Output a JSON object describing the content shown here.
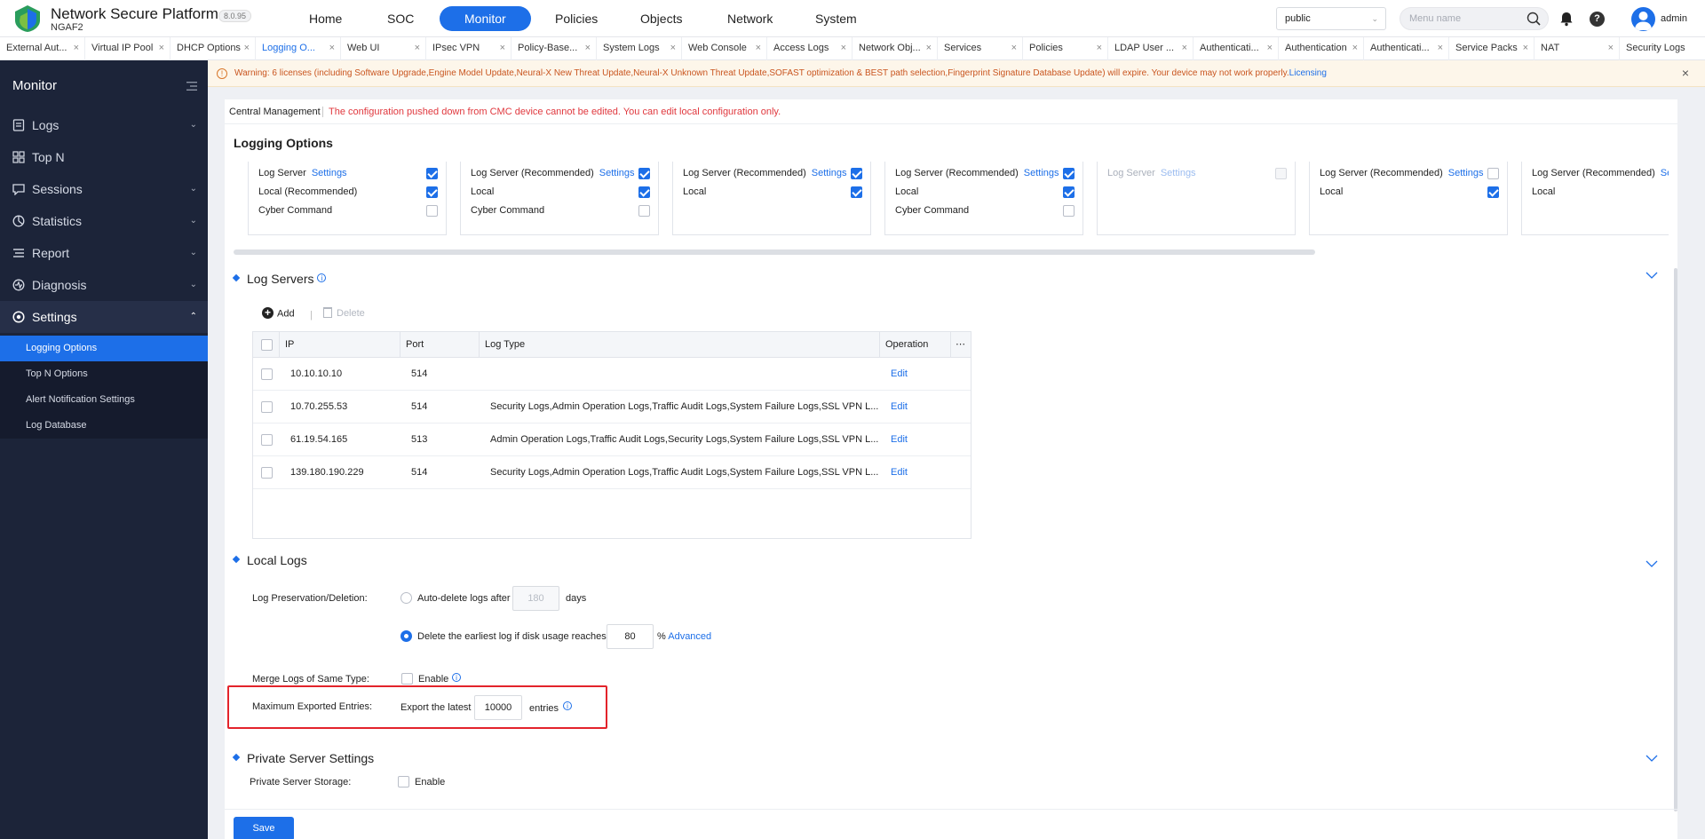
{
  "app": {
    "title": "Network Secure Platform",
    "subtitle": "NGAF2",
    "version": "8.0.95"
  },
  "nav": {
    "items": [
      "Home",
      "SOC",
      "Monitor",
      "Policies",
      "Objects",
      "Network",
      "System"
    ],
    "active": "Monitor"
  },
  "header": {
    "scope_value": "public",
    "search_placeholder": "Menu name",
    "username": "admin"
  },
  "tabs": [
    {
      "label": "External Aut...",
      "active": false
    },
    {
      "label": "Virtual IP Pool",
      "active": false
    },
    {
      "label": "DHCP Options",
      "active": false
    },
    {
      "label": "Logging O...",
      "active": true
    },
    {
      "label": "Web UI",
      "active": false
    },
    {
      "label": "IPsec VPN",
      "active": false
    },
    {
      "label": "Policy-Base...",
      "active": false
    },
    {
      "label": "System Logs",
      "active": false
    },
    {
      "label": "Web Console",
      "active": false
    },
    {
      "label": "Access Logs",
      "active": false
    },
    {
      "label": "Network Obj...",
      "active": false
    },
    {
      "label": "Services",
      "active": false
    },
    {
      "label": "Policies",
      "active": false
    },
    {
      "label": "LDAP User ...",
      "active": false
    },
    {
      "label": "Authenticati...",
      "active": false
    },
    {
      "label": "Authentication",
      "active": false
    },
    {
      "label": "Authenticati...",
      "active": false
    },
    {
      "label": "Service Packs",
      "active": false
    },
    {
      "label": "NAT",
      "active": false
    },
    {
      "label": "Security Logs",
      "active": false
    }
  ],
  "sidebar": {
    "title": "Monitor",
    "items": [
      {
        "label": "Logs",
        "icon": "logs-icon"
      },
      {
        "label": "Top N",
        "icon": "grid-icon"
      },
      {
        "label": "Sessions",
        "icon": "sessions-icon"
      },
      {
        "label": "Statistics",
        "icon": "statistics-icon"
      },
      {
        "label": "Report",
        "icon": "report-icon"
      },
      {
        "label": "Diagnosis",
        "icon": "diagnosis-icon"
      },
      {
        "label": "Settings",
        "icon": "settings-icon"
      }
    ],
    "sub_items": [
      "Logging Options",
      "Top N Options",
      "Alert Notification Settings",
      "Log Database"
    ],
    "active_sub": "Logging Options"
  },
  "warning": {
    "text": "Warning: 6 licenses (including Software Upgrade,Engine Model Update,Neural-X New Threat Update,Neural-X Unknown Threat Update,SOFAST optimization & BEST path selection,Fingerprint Signature Database Update) will expire. Your device may not work properly.",
    "link": "Licensing"
  },
  "central_management": {
    "label": "Central Management",
    "message": "The configuration pushed down from CMC device cannot be edited. You can edit local configuration only."
  },
  "page_title": "Logging Options",
  "log_cards": [
    {
      "rows": [
        {
          "label": "Log Server",
          "settings": "Settings",
          "checked": true
        },
        {
          "label": "Local (Recommended)",
          "checked": true
        },
        {
          "label": "Cyber Command",
          "checked": false
        }
      ],
      "disabled": false
    },
    {
      "rows": [
        {
          "label": "Log Server (Recommended)",
          "settings": "Settings",
          "checked": true
        },
        {
          "label": "Local",
          "checked": true
        },
        {
          "label": "Cyber Command",
          "checked": false
        }
      ],
      "disabled": false
    },
    {
      "rows": [
        {
          "label": "Log Server (Recommended)",
          "settings": "Settings",
          "checked": true
        },
        {
          "label": "Local",
          "checked": true
        }
      ],
      "disabled": false
    },
    {
      "rows": [
        {
          "label": "Log Server (Recommended)",
          "settings": "Settings",
          "checked": true
        },
        {
          "label": "Local",
          "checked": true
        },
        {
          "label": "Cyber Command",
          "checked": false
        }
      ],
      "disabled": false
    },
    {
      "rows": [
        {
          "label": "Log Server",
          "settings": "Settings",
          "checked": false
        }
      ],
      "disabled": true
    },
    {
      "rows": [
        {
          "label": "Log Server (Recommended)",
          "settings": "Settings",
          "checked": false
        },
        {
          "label": "Local",
          "checked": true
        }
      ],
      "disabled": false
    },
    {
      "rows": [
        {
          "label": "Log Server (Recommended)",
          "settings": "Se",
          "checked": null
        },
        {
          "label": "Local",
          "checked": null
        }
      ],
      "disabled": false
    }
  ],
  "log_servers": {
    "title": "Log Servers",
    "add_label": "Add",
    "delete_label": "Delete",
    "columns": [
      "IP",
      "Port",
      "Log Type",
      "Operation"
    ],
    "rows": [
      {
        "ip": "10.10.10.10",
        "port": "514",
        "log_type": "",
        "op": "Edit"
      },
      {
        "ip": "10.70.255.53",
        "port": "514",
        "log_type": "Security Logs,Admin Operation Logs,Traffic Audit Logs,System Failure Logs,SSL VPN L...",
        "op": "Edit"
      },
      {
        "ip": "61.19.54.165",
        "port": "513",
        "log_type": "Admin Operation Logs,Traffic Audit Logs,Security Logs,System Failure Logs,SSL VPN L...",
        "op": "Edit"
      },
      {
        "ip": "139.180.190.229",
        "port": "514",
        "log_type": "Security Logs,Admin Operation Logs,Traffic Audit Logs,System Failure Logs,SSL VPN L...",
        "op": "Edit"
      }
    ]
  },
  "local_logs": {
    "title": "Local Logs",
    "preservation_label": "Log Preservation/Deletion:",
    "auto_delete_label": "Auto-delete logs after",
    "auto_delete_value": "180",
    "days_label": "days",
    "delete_earliest_label": "Delete the earliest log if disk usage reaches",
    "disk_usage_value": "80",
    "percent_label": "%",
    "advanced_label": "Advanced",
    "merge_label": "Merge Logs of Same Type:",
    "enable_label": "Enable",
    "max_export_label": "Maximum Exported Entries:",
    "export_prefix": "Export the latest",
    "export_value": "10000",
    "export_suffix": "entries"
  },
  "private_server": {
    "title": "Private Server Settings",
    "storage_label": "Private Server Storage:",
    "enable_label": "Enable"
  },
  "save_label": "Save",
  "colors": {
    "accent": "#1d6fe8",
    "sidebar": "#1c2439",
    "warning_text": "#c9551f",
    "error_text": "#e0383e",
    "highlight": "#e3232b"
  }
}
